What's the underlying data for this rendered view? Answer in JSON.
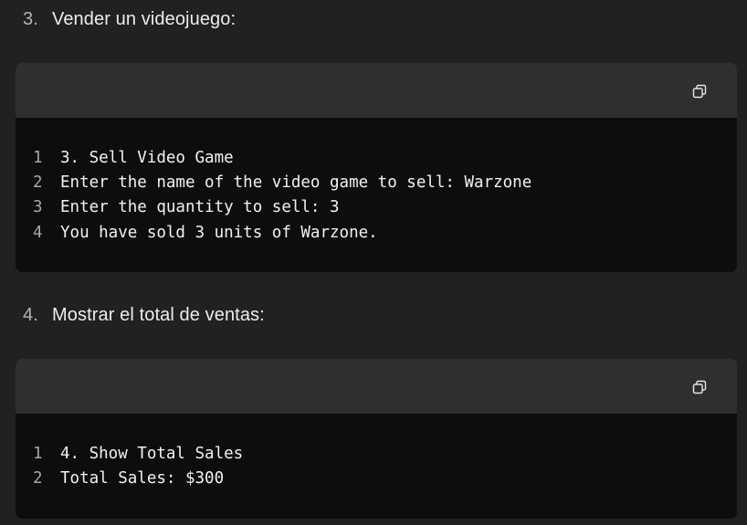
{
  "sections": [
    {
      "number": "3.",
      "label": "Vender un videojuego:",
      "code_lines": [
        {
          "n": "1",
          "text": "3. Sell Video Game"
        },
        {
          "n": "2",
          "text": "Enter the name of the video game to sell: Warzone"
        },
        {
          "n": "3",
          "text": "Enter the quantity to sell: 3"
        },
        {
          "n": "4",
          "text": "You have sold 3 units of Warzone."
        }
      ]
    },
    {
      "number": "4.",
      "label": "Mostrar el total de ventas:",
      "code_lines": [
        {
          "n": "1",
          "text": "4. Show Total Sales"
        },
        {
          "n": "2",
          "text": "Total Sales: $300"
        }
      ]
    }
  ],
  "icons": {
    "copy": "copy-icon"
  },
  "colors": {
    "page_bg": "#212121",
    "code_header_bg": "#2f2f2f",
    "code_body_bg": "#0d0d0d",
    "text": "#ececec",
    "muted": "#b4b4b4"
  }
}
